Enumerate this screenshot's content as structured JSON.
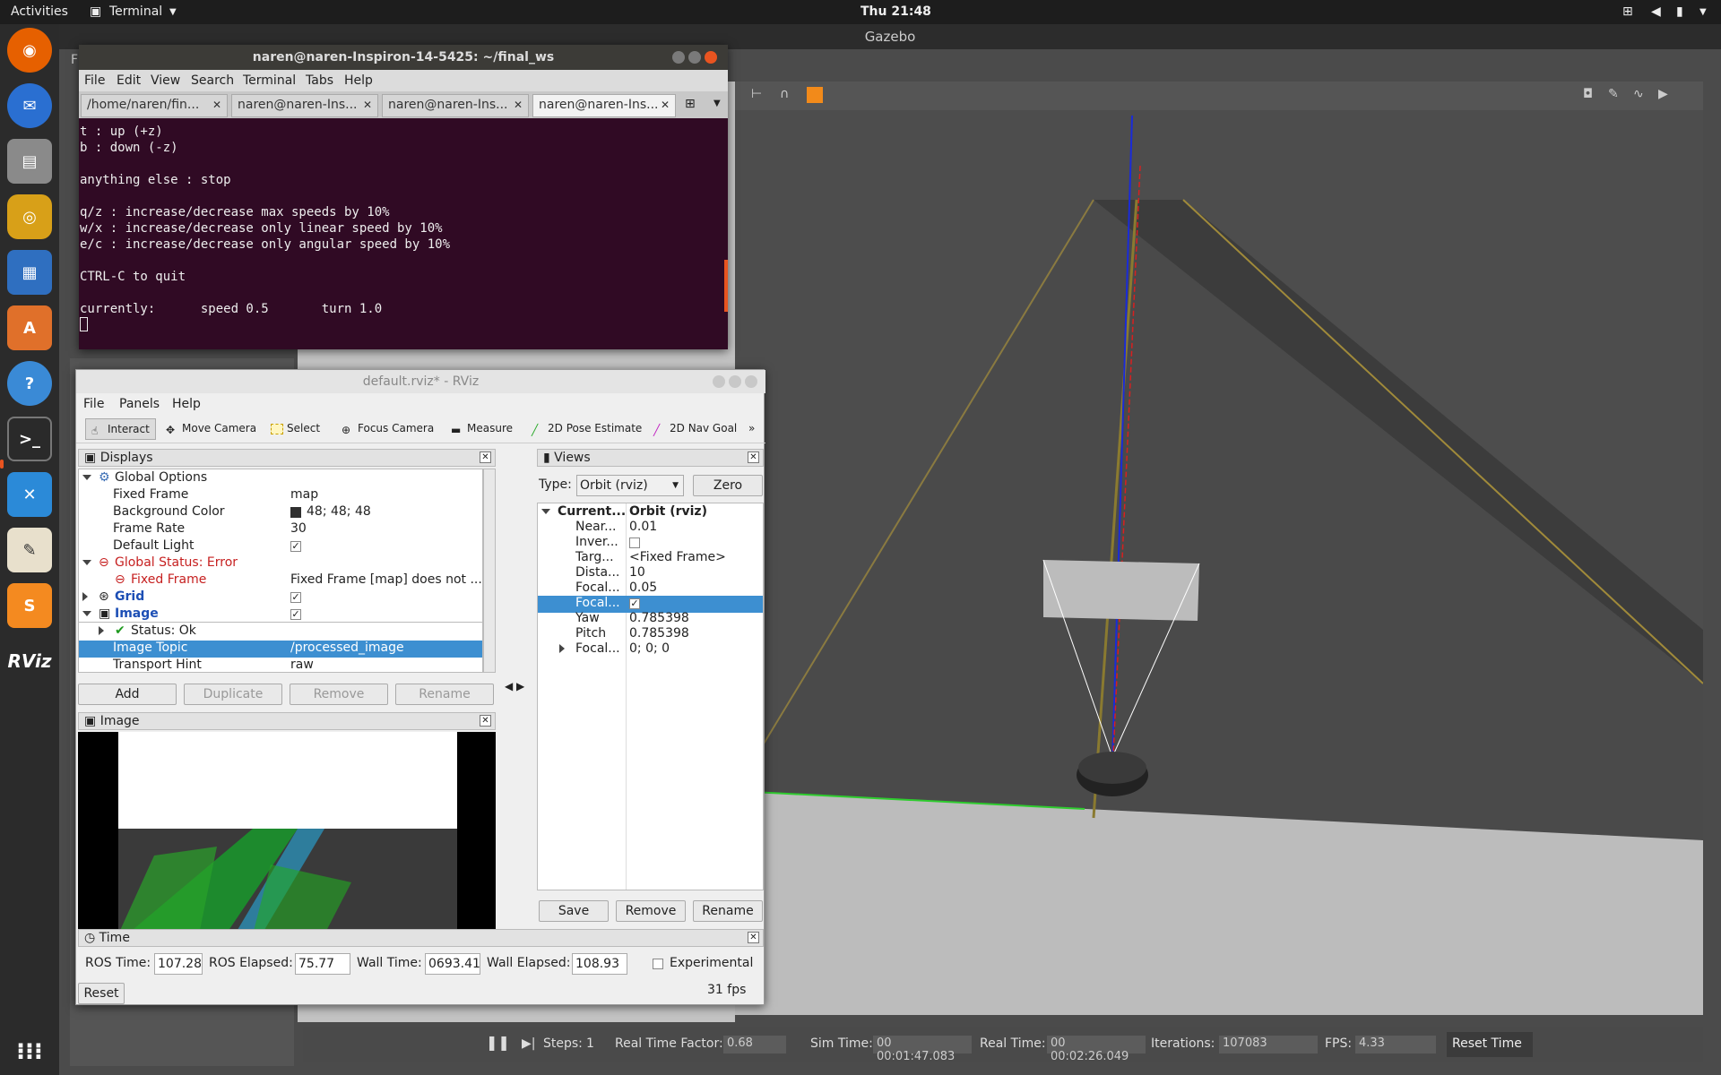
{
  "topbar": {
    "activities": "Activities",
    "app": "Terminal",
    "clock": "Thu 21:48"
  },
  "dock": {
    "items": [
      "firefox-icon",
      "thunderbird-icon",
      "files-icon",
      "rhythmbox-icon",
      "writer-icon",
      "software-icon",
      "help-icon",
      "terminal-icon",
      "vscode-icon",
      "text-editor-icon",
      "sublime-icon",
      "rviz-icon",
      "apps-grid-icon"
    ],
    "rviz_label": "RViz"
  },
  "gazebo": {
    "title": "Gazebo",
    "bottom": {
      "steps_label": "Steps:",
      "steps_value": "1",
      "rtf_label": "Real Time Factor:",
      "rtf_value": "0.68",
      "sim_label": "Sim Time:",
      "sim_value": "00 00:01:47.083",
      "real_label": "Real Time:",
      "real_value": "00 00:02:26.049",
      "iter_label": "Iterations:",
      "iter_value": "107083",
      "fps_label": "FPS:",
      "fps_value": "4.33",
      "reset_label": "Reset Time"
    },
    "side_letter": "F"
  },
  "terminal": {
    "title": "naren@naren-Inspiron-14-5425: ~/final_ws",
    "menu": [
      "File",
      "Edit",
      "View",
      "Search",
      "Terminal",
      "Tabs",
      "Help"
    ],
    "tabs": [
      "/home/naren/fin...",
      "naren@naren-Ins...",
      "naren@naren-Ins...",
      "naren@naren-Ins..."
    ],
    "lines": [
      "t : up (+z)",
      "b : down (-z)",
      "",
      "anything else : stop",
      "",
      "q/z : increase/decrease max speeds by 10%",
      "w/x : increase/decrease only linear speed by 10%",
      "e/c : increase/decrease only angular speed by 10%",
      "",
      "CTRL-C to quit",
      "",
      "currently:      speed 0.5       turn 1.0"
    ]
  },
  "rviz": {
    "title": "default.rviz* - RViz",
    "menu": [
      "File",
      "Panels",
      "Help"
    ],
    "tools": [
      "Interact",
      "Move Camera",
      "Select",
      "Focus Camera",
      "Measure",
      "2D Pose Estimate",
      "2D Nav Goal"
    ],
    "more": "»",
    "displays": {
      "title": "Displays",
      "global_options": "Global Options",
      "fixed_frame_k": "Fixed Frame",
      "fixed_frame_v": "map",
      "bg_color_k": "Background Color",
      "bg_color_v": "48; 48; 48",
      "frame_rate_k": "Frame Rate",
      "frame_rate_v": "30",
      "default_light_k": "Default Light",
      "global_status": "Global Status: Error",
      "ff_error_k": "Fixed Frame",
      "ff_error_v": "Fixed Frame [map] does not ...",
      "grid": "Grid",
      "image": "Image",
      "status_ok": "Status: Ok",
      "image_topic_k": "Image Topic",
      "image_topic_v": "/processed_image",
      "transport_k": "Transport Hint",
      "transport_v": "raw",
      "buttons": [
        "Add",
        "Duplicate",
        "Remove",
        "Rename"
      ]
    },
    "views": {
      "title": "Views",
      "type_label": "Type:",
      "type_value": "Orbit (rviz)",
      "zero": "Zero",
      "current_k": "Current...",
      "current_v": "Orbit (rviz)",
      "rows": [
        {
          "k": "Near...",
          "v": "0.01"
        },
        {
          "k": "Inver...",
          "v": ""
        },
        {
          "k": "Targ...",
          "v": "<Fixed Frame>"
        },
        {
          "k": "Dista...",
          "v": "10"
        },
        {
          "k": "Focal...",
          "v": "0.05"
        },
        {
          "k": "Focal...",
          "v": ""
        },
        {
          "k": "Yaw",
          "v": "0.785398"
        },
        {
          "k": "Pitch",
          "v": "0.785398"
        },
        {
          "k": "Focal...",
          "v": "0; 0; 0"
        }
      ],
      "buttons": [
        "Save",
        "Remove",
        "Rename"
      ]
    },
    "image_panel": {
      "title": "Image"
    },
    "time": {
      "title": "Time",
      "ros_time_label": "ROS Time:",
      "ros_time": "107.28",
      "ros_elapsed_label": "ROS Elapsed:",
      "ros_elapsed": "75.77",
      "wall_time_label": "Wall Time:",
      "wall_time": "0693.41",
      "wall_elapsed_label": "Wall Elapsed:",
      "wall_elapsed": "108.93",
      "experimental": "Experimental",
      "reset": "Reset",
      "fps": "31 fps"
    }
  },
  "colors": {
    "accent": "#e95420",
    "selection": "#3d8fd1",
    "terminal_bg": "#300a24"
  }
}
